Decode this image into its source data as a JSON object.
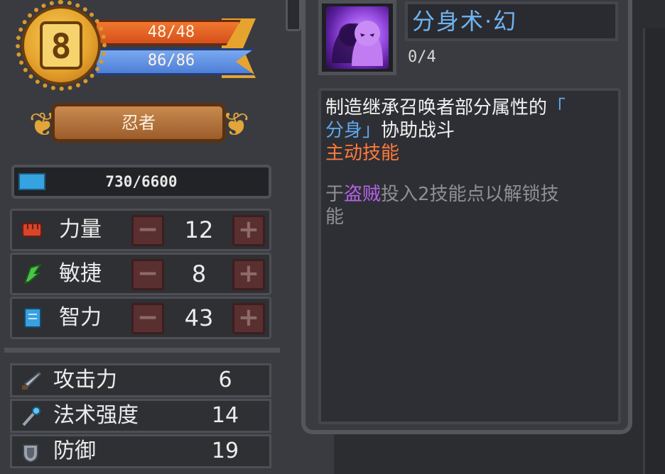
{
  "level": {
    "value": "8"
  },
  "hp": {
    "text": "48/48"
  },
  "mp": {
    "text": "86/86"
  },
  "class": {
    "name": "忍者"
  },
  "experience": {
    "text": "730/6600",
    "fill_fraction": 0.11
  },
  "stats": [
    {
      "label": "力量",
      "value": "12",
      "icon": "fist-icon",
      "minus": "−",
      "plus": "+"
    },
    {
      "label": "敏捷",
      "value": "8",
      "icon": "feather-icon",
      "minus": "−",
      "plus": "+"
    },
    {
      "label": "智力",
      "value": "43",
      "icon": "book-icon",
      "minus": "−",
      "plus": "+"
    }
  ],
  "attributes": [
    {
      "label": "攻击力",
      "value": "6",
      "icon": "sword-icon"
    },
    {
      "label": "法术强度",
      "value": "14",
      "icon": "wand-icon"
    },
    {
      "label": "防御",
      "value": "19",
      "icon": "shield-icon"
    }
  ],
  "skill": {
    "name": "分身术·幻",
    "level": "0/4",
    "icon": "shadow-clone-icon",
    "description": {
      "part1": "制造继承召唤者部分属性的",
      "quote_open": "「",
      "clone_term": "分身",
      "quote_close": "」",
      "part2": "协助战斗"
    },
    "type": "主动技能",
    "unlock": {
      "prefix": "于",
      "class_term": "盗贼",
      "suffix": "投入2技能点以解锁技",
      "wrap": "能"
    }
  },
  "colors": {
    "hp": "#e8622a",
    "mp": "#5b8ee0",
    "exp": "#35a3e0",
    "skill_name": "#6fb3f0",
    "active_skill": "#ff7a3a",
    "class_highlight": "#b462e8"
  }
}
